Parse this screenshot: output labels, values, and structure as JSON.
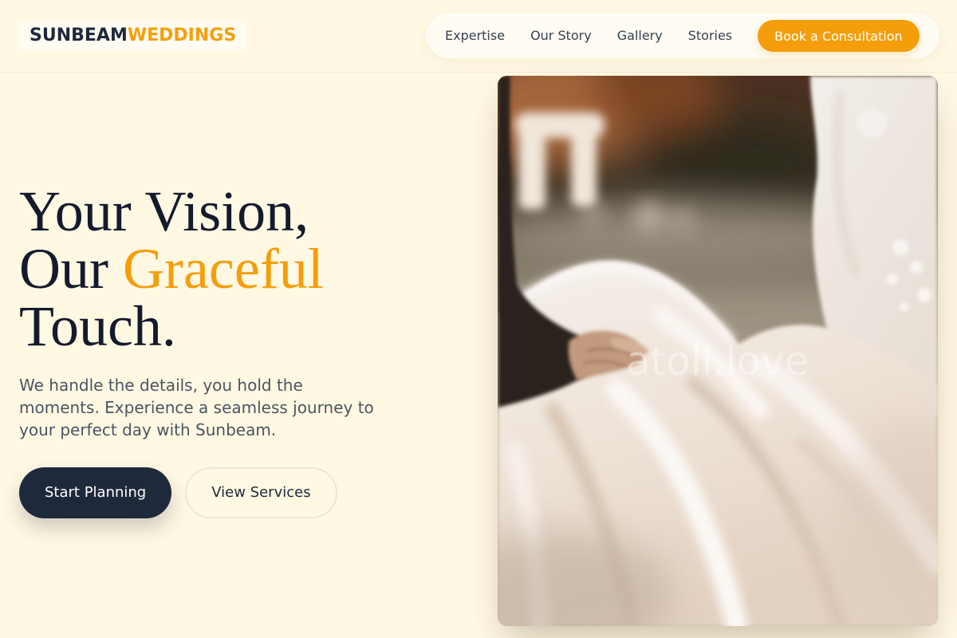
{
  "brand": {
    "name": "SUNBEAM",
    "highlight": "WEDDINGS"
  },
  "nav": {
    "links": [
      "Expertise",
      "Our Story",
      "Gallery",
      "Stories"
    ],
    "cta_label": "Book a Consultation"
  },
  "hero": {
    "heading": {
      "line1": "Your Vision,",
      "line2_prefix": "Our",
      "line2_highlight": "Graceful",
      "line3": "Touch."
    },
    "description": "We handle the details, you hold the moments. Experience a seamless journey to your perfect day with Sunbeam.",
    "primary_button_label": "Start Planning",
    "secondary_button_label": "View Services",
    "image": {
      "watermark": "atoll.love"
    }
  },
  "colors": {
    "page_background": "#FFF8E3",
    "accent": "#F59E0B",
    "navy": "#1E293B",
    "heading_text": "#141B2D",
    "body_text": "#4B5563"
  }
}
